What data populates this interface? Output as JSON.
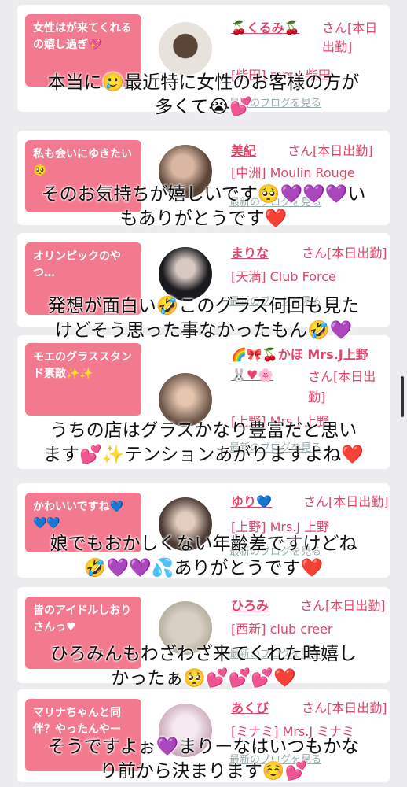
{
  "cards": [
    {
      "bubble": "女性はが来てくれるの嬉し過ぎ💖",
      "name": "🍒くるみ🍒",
      "status": "さん[本日出勤]",
      "shop": "[柴田] mrs.J 柴田",
      "blog": "最新のブログを見る"
    },
    {
      "bubble": "私も会いにゆきたい🥺",
      "name": "美紀",
      "status": "さん[本日出勤]",
      "shop": "[中洲] Moulin Rouge",
      "blog": "最新のブログを見る"
    },
    {
      "bubble": "オリンピックのやつ…",
      "name": "まりな",
      "status": "さん[本日出勤]",
      "shop": "[天満] Club Force",
      "blog": "最新のブログを見る"
    },
    {
      "bubble": "モエのグラススタンド素敵✨✨",
      "name": "🌈🎀🍒かほ Mrs.J上野🐰♥🌸",
      "status": "さん[本日出勤]",
      "shop": "[上野] Mrs.J 上野",
      "blog": "最新のブログを見る"
    },
    {
      "bubble": "かわいいですね💙💙💙",
      "name": "ゆり💙",
      "status": "さん[本日出勤]",
      "shop": "[上野] Mrs.J 上野",
      "blog": "最新のブログを見る"
    },
    {
      "bubble": "皆のアイドルしおりさんっ♥",
      "name": "ひろみ",
      "status": "さん[本日出勤]",
      "shop": "[西新] club creer",
      "blog": "最新のブログを見る"
    },
    {
      "bubble": "マリナちゃんと同伴？やったんやー",
      "name": "あくび",
      "status": "さん[本日出勤]",
      "shop": "[ミナミ] Mrs.J ミナミ",
      "blog": "最新のブログを見る"
    }
  ],
  "overlays": [
    "本当に🥲最近特に女性のお客様の方が\n多くて😭💕",
    "そのお気持ちが嬉しいです🥺💜💜💜い\nもありがとうです❤️",
    "発想が面白い🤣このグラス何回も見た\nけどそう思った事なかったもん🤣💜",
    "うちの店はグラスかなり豊富だと思い\nます💕✨テンションあがりますよね❤️",
    "娘でもおかしくない年齢差ですけどね\n🤣💜💜💦ありがとうです❤️",
    "ひろみんもわざわざ来てくれた時嬉し\nかったぁ🥺💕💕💕❤️",
    "そうですよぉ💜まりーなはいつもかな\nり前から決まります☺️💕"
  ]
}
